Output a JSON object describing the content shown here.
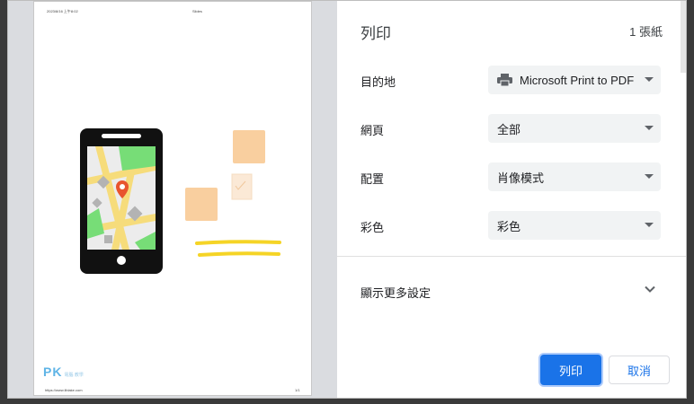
{
  "preview": {
    "header_left": "2023/8/16 上午8:02",
    "header_center": "Slides",
    "footer_left": "https://www.liblake.com",
    "footer_right": "1/1",
    "watermark": "PK",
    "watermark_sub": "電腦 教學"
  },
  "settings": {
    "title": "列印",
    "sheet_count": "1 張紙",
    "destination": {
      "label": "目的地",
      "value": "Microsoft Print to PDF",
      "icon": "printer-icon"
    },
    "pages": {
      "label": "網頁",
      "value": "全部"
    },
    "layout": {
      "label": "配置",
      "value": "肖像模式"
    },
    "color": {
      "label": "彩色",
      "value": "彩色"
    },
    "more_settings": "顯示更多設定"
  },
  "buttons": {
    "print": "列印",
    "cancel": "取消"
  },
  "colors": {
    "accent": "#1a73e8",
    "select_bg": "#f1f3f4"
  }
}
